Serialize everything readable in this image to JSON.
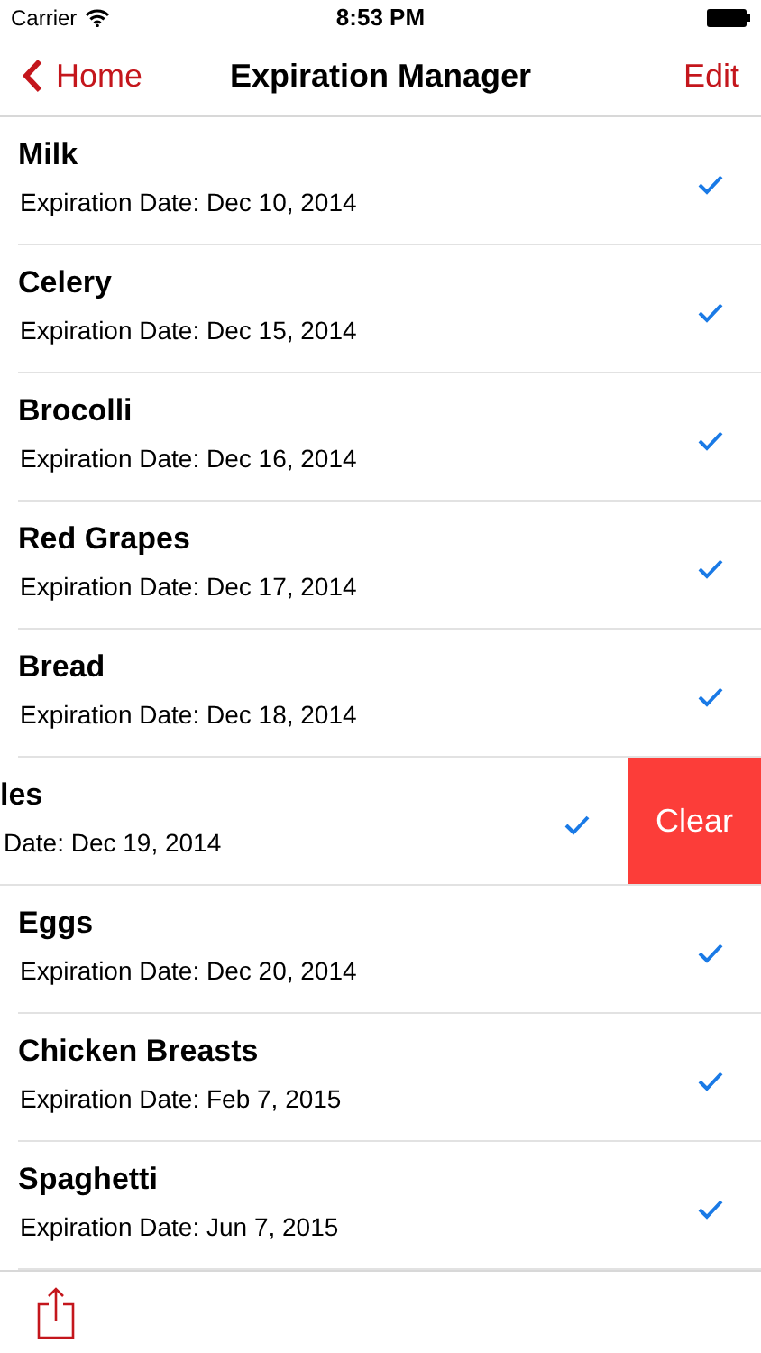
{
  "status_bar": {
    "carrier": "Carrier",
    "time": "8:53 PM"
  },
  "nav": {
    "back": "Home",
    "title": "Expiration Manager",
    "action": "Edit"
  },
  "items": [
    {
      "name": "Milk",
      "date": "Expiration Date: Dec 10, 2014",
      "checked": true,
      "swiped": false
    },
    {
      "name": "Celery",
      "date": "Expiration Date: Dec 15, 2014",
      "checked": true,
      "swiped": false
    },
    {
      "name": "Brocolli",
      "date": "Expiration Date: Dec 16, 2014",
      "checked": true,
      "swiped": false
    },
    {
      "name": "Red Grapes",
      "date": "Expiration Date: Dec 17, 2014",
      "checked": true,
      "swiped": false
    },
    {
      "name": "Bread",
      "date": "Expiration Date: Dec 18, 2014",
      "checked": true,
      "swiped": false
    },
    {
      "name": "les",
      "date": "Date: Dec 19, 2014",
      "checked": true,
      "swiped": true,
      "swipe_action": "Clear"
    },
    {
      "name": "Eggs",
      "date": "Expiration Date: Dec 20, 2014",
      "checked": true,
      "swiped": false
    },
    {
      "name": "Chicken Breasts",
      "date": "Expiration Date: Feb 7, 2015",
      "checked": true,
      "swiped": false
    },
    {
      "name": "Spaghetti",
      "date": "Expiration Date: Jun 7, 2015",
      "checked": true,
      "swiped": false
    }
  ]
}
